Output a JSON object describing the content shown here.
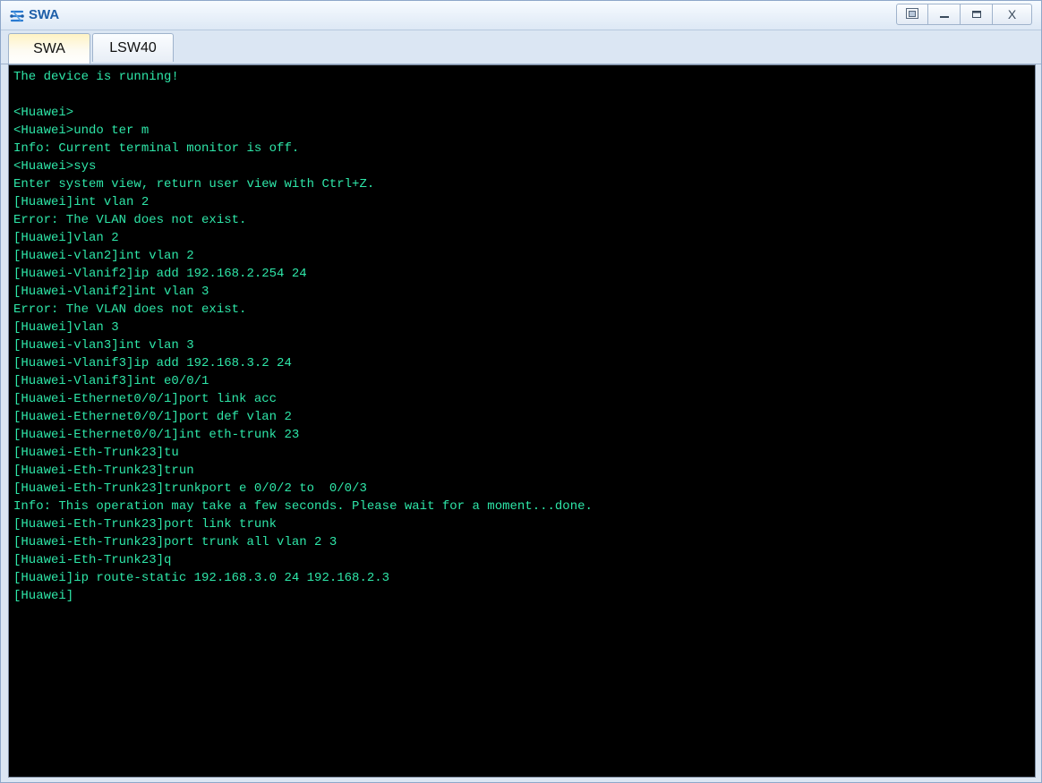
{
  "window": {
    "title": "SWA",
    "app_icon": "network-device-icon",
    "controls": {
      "restore_icon": "restore-window-icon",
      "minimize_icon": "minimize-icon",
      "maximize_icon": "maximize-icon",
      "close_label": "X"
    }
  },
  "tabs": [
    {
      "label": "SWA",
      "active": true
    },
    {
      "label": "LSW40",
      "active": false
    }
  ],
  "terminal": {
    "text_color": "#2ee6a8",
    "background": "#000000",
    "lines": [
      "The device is running!",
      "",
      "<Huawei>",
      "<Huawei>undo ter m",
      "Info: Current terminal monitor is off.",
      "<Huawei>sys",
      "Enter system view, return user view with Ctrl+Z.",
      "[Huawei]int vlan 2",
      "Error: The VLAN does not exist.",
      "[Huawei]vlan 2",
      "[Huawei-vlan2]int vlan 2",
      "[Huawei-Vlanif2]ip add 192.168.2.254 24",
      "[Huawei-Vlanif2]int vlan 3",
      "Error: The VLAN does not exist.",
      "[Huawei]vlan 3",
      "[Huawei-vlan3]int vlan 3",
      "[Huawei-Vlanif3]ip add 192.168.3.2 24",
      "[Huawei-Vlanif3]int e0/0/1",
      "[Huawei-Ethernet0/0/1]port link acc",
      "[Huawei-Ethernet0/0/1]port def vlan 2",
      "[Huawei-Ethernet0/0/1]int eth-trunk 23",
      "[Huawei-Eth-Trunk23]tu",
      "[Huawei-Eth-Trunk23]trun",
      "[Huawei-Eth-Trunk23]trunkport e 0/0/2 to  0/0/3",
      "Info: This operation may take a few seconds. Please wait for a moment...done.",
      "[Huawei-Eth-Trunk23]port link trunk",
      "[Huawei-Eth-Trunk23]port trunk all vlan 2 3",
      "[Huawei-Eth-Trunk23]q",
      "[Huawei]ip route-static 192.168.3.0 24 192.168.2.3",
      "[Huawei]"
    ]
  }
}
